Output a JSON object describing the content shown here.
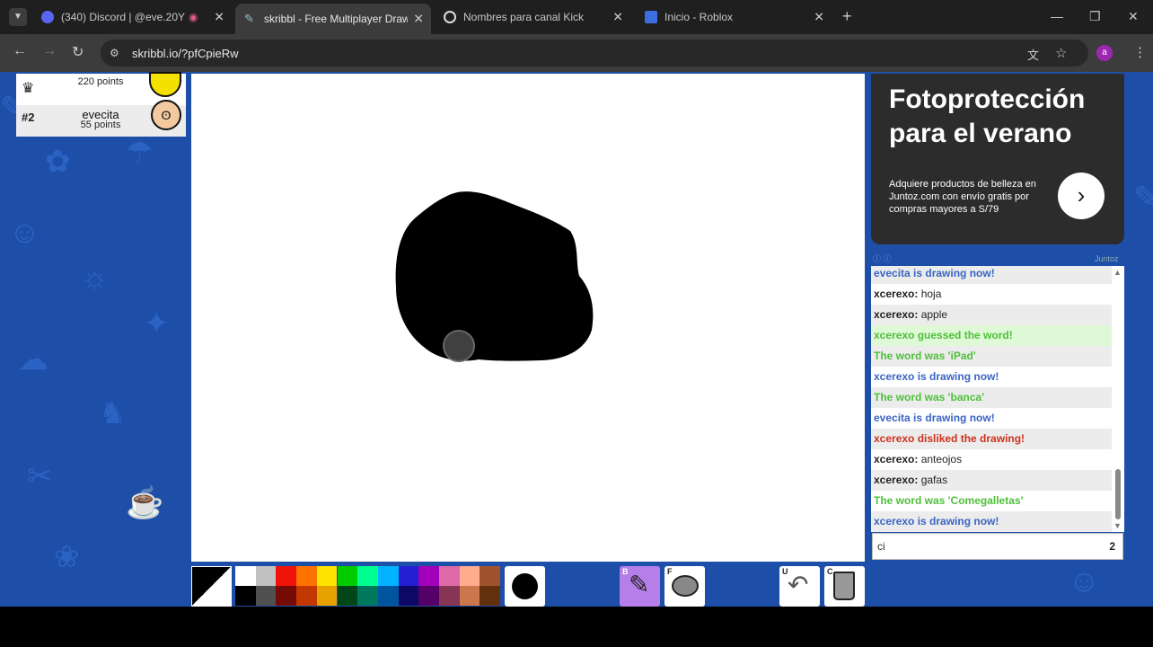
{
  "browser": {
    "tabs": [
      {
        "title": "(340) Discord | @eve.20Y",
        "badge": "340",
        "active": false
      },
      {
        "title": "skribbl - Free Multiplayer Drawi",
        "active": true
      },
      {
        "title": "Nombres para canal Kick",
        "active": false
      },
      {
        "title": "Inicio - Roblox",
        "active": false
      }
    ],
    "new_tab": "+",
    "url": "skribbl.io/?pfCpieRw",
    "profile_initial": "a"
  },
  "players": [
    {
      "rank": "",
      "name": "",
      "points": "220 points"
    },
    {
      "rank": "#2",
      "name": "evecita",
      "points": "55 points"
    }
  ],
  "ad": {
    "title": "Fotoprotección para el verano",
    "body": "Adquiere productos de belleza en Juntoz.com con envío gratis por compras mayores a S/79",
    "source": "Juntoz"
  },
  "chat": {
    "messages": [
      {
        "text": "evecita is drawing now!",
        "style": "blue"
      },
      {
        "user": "xcerexo:",
        "text": " hoja",
        "style": "black"
      },
      {
        "user": "xcerexo:",
        "text": " apple",
        "style": "black"
      },
      {
        "text": "xcerexo guessed the word!",
        "style": "green-hl"
      },
      {
        "text": "The word was 'iPad'",
        "style": "green"
      },
      {
        "text": "xcerexo is drawing now!",
        "style": "blue"
      },
      {
        "text": "The word was 'banca'",
        "style": "green"
      },
      {
        "text": "evecita is drawing now!",
        "style": "blue"
      },
      {
        "text": "xcerexo disliked the drawing!",
        "style": "red"
      },
      {
        "user": "xcerexo:",
        "text": " anteojos",
        "style": "black"
      },
      {
        "user": "xcerexo:",
        "text": " gafas",
        "style": "black"
      },
      {
        "text": "The word was 'Comegalletas'",
        "style": "green"
      },
      {
        "text": "xcerexo is drawing now!",
        "style": "blue"
      }
    ],
    "input_value": "ci",
    "input_count": "2"
  },
  "tools": {
    "palette_top": [
      "#ffffff",
      "#c1c1c1",
      "#ef130b",
      "#ff7100",
      "#ffe400",
      "#00cc00",
      "#00ff91",
      "#00b2ff",
      "#231fd3",
      "#a300ba",
      "#df69a7",
      "#ffac8e",
      "#a0522d"
    ],
    "palette_bottom": [
      "#000000",
      "#505050",
      "#740b07",
      "#c23800",
      "#e8a200",
      "#004619",
      "#00785d",
      "#00569e",
      "#0e0865",
      "#550069",
      "#873554",
      "#cc774d",
      "#63300d"
    ],
    "brush_key": "B",
    "fill_key": "F",
    "undo_key": "U",
    "clear_key": "C"
  }
}
